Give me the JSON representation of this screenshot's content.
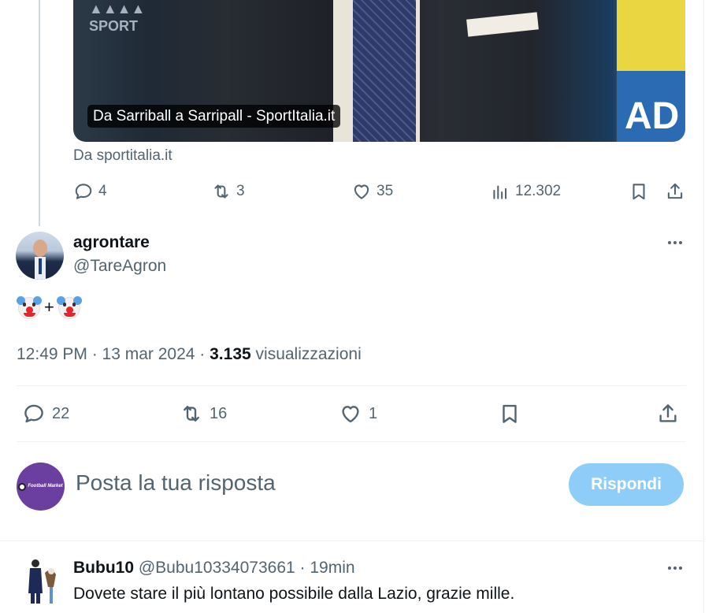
{
  "quoted_card": {
    "caption": "Da Sarriball a Sarripall - SportItalia.it",
    "source": "Da sportitalia.it",
    "actions": {
      "replies": "4",
      "retweets": "3",
      "likes": "35",
      "views": "12.302"
    }
  },
  "tweet": {
    "display_name": "agrontare",
    "handle": "@TareAgron",
    "body_plus": "+",
    "time": "12:49 PM · 13 mar 2024 · ",
    "views_count": "3.135",
    "views_label": " visualizzazioni",
    "actions": {
      "replies": "22",
      "retweets": "16",
      "likes": "1"
    }
  },
  "composer": {
    "placeholder": "Posta la tua risposta",
    "reply_button": "Rispondi",
    "avatar_text": "Football Market"
  },
  "reply": {
    "display_name": "Bubu10",
    "handle_time": " @Bubu10334073661 · 19min",
    "text": "Dovete stare il più lontano possibile dalla Lazio, grazie mille."
  },
  "colors": {
    "accent_disabled": "#8ecdf8",
    "secondary_text": "#536471",
    "primary_text": "#0f1419"
  }
}
